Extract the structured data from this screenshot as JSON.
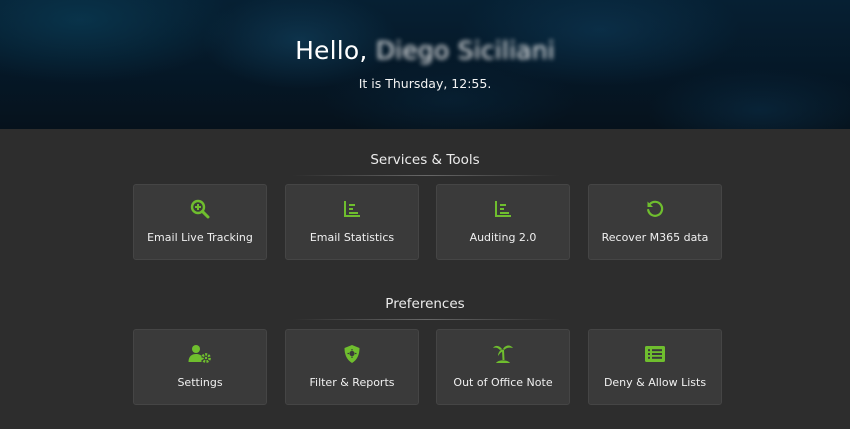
{
  "header": {
    "greeting_prefix": "Hello,",
    "user_name": "Diego Siciliani",
    "datetime": "It is Thursday, 12:55."
  },
  "services": {
    "title": "Services & Tools",
    "cards": [
      {
        "label": "Email Live Tracking",
        "icon": "search-plus-icon"
      },
      {
        "label": "Email Statistics",
        "icon": "bar-chart-icon"
      },
      {
        "label": "Auditing 2.0",
        "icon": "bar-chart-icon"
      },
      {
        "label": "Recover M365 data",
        "icon": "undo-icon"
      }
    ]
  },
  "preferences": {
    "title": "Preferences",
    "cards": [
      {
        "label": "Settings",
        "icon": "user-gear-icon"
      },
      {
        "label": "Filter & Reports",
        "icon": "shield-virus-icon"
      },
      {
        "label": "Out of Office Note",
        "icon": "palm-tree-icon"
      },
      {
        "label": "Deny & Allow Lists",
        "icon": "list-icon"
      }
    ]
  },
  "colors": {
    "accent": "#6fbe2e",
    "background": "#2d2d2d",
    "card": "#3a3a3a",
    "header": "#062033"
  }
}
